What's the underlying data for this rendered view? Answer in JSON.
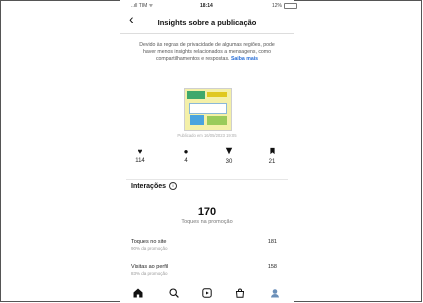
{
  "status_bar": {
    "carrier": "..ıll TIM ᯤ",
    "time": "18:14",
    "battery": "12%"
  },
  "header": {
    "title": "Insights sobre a publicação"
  },
  "notice": {
    "text": "Devido às regras de privacidade de algumas regiões, pode haver menos insights relacionados a mensagens, como compartilhamentos e respostas.",
    "link": "Saiba mais"
  },
  "post": {
    "published": "Publicado em 16/05/2023 19:05"
  },
  "stats": [
    {
      "icon": "heart-icon",
      "value": "114"
    },
    {
      "icon": "comment-icon",
      "value": "4"
    },
    {
      "icon": "share-icon",
      "value": "30"
    },
    {
      "icon": "bookmark-icon",
      "value": "21"
    }
  ],
  "interactions": {
    "title": "Interações",
    "total": "170",
    "total_label": "Toques na promoção",
    "rows": [
      {
        "label": "Toques no site",
        "sub": "90% da promoção",
        "value": "181"
      },
      {
        "label": "Visitas ao perfil",
        "sub": "83% da promoção",
        "value": "158"
      }
    ]
  },
  "tabbar": [
    "home-icon",
    "search-icon",
    "reels-icon",
    "shop-icon",
    "profile-icon"
  ]
}
